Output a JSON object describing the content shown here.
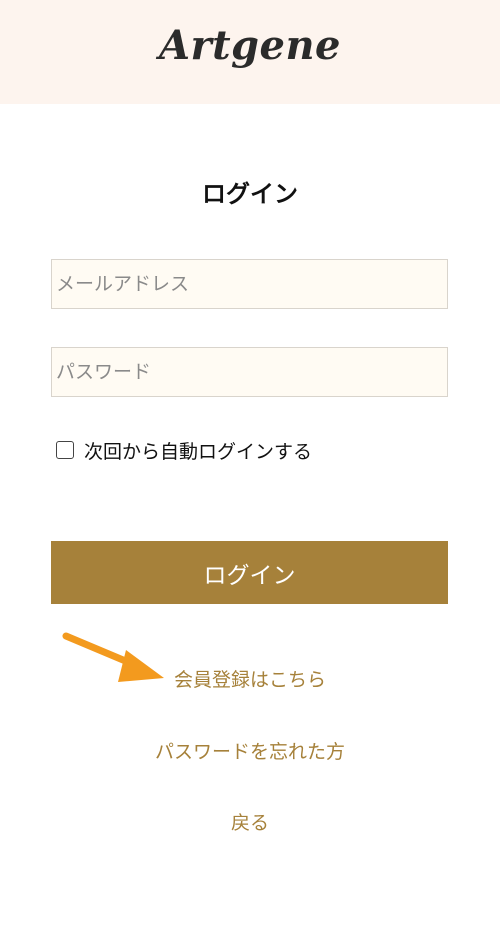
{
  "header": {
    "logo_text": "Artgene"
  },
  "login": {
    "title": "ログイン",
    "email_placeholder": "メールアドレス",
    "password_placeholder": "パスワード",
    "remember_label": "次回から自動ログインする",
    "submit_label": "ログイン"
  },
  "links": {
    "register": "会員登録はこちら",
    "forgot_password": "パスワードを忘れた方",
    "back": "戻る"
  },
  "annotation": {
    "arrow_icon": "arrow-right-icon",
    "arrow_color": "#f39a1e"
  },
  "colors": {
    "header_bg": "#fdf4ee",
    "accent": "#a6813a",
    "field_bg": "#fffbf3"
  }
}
